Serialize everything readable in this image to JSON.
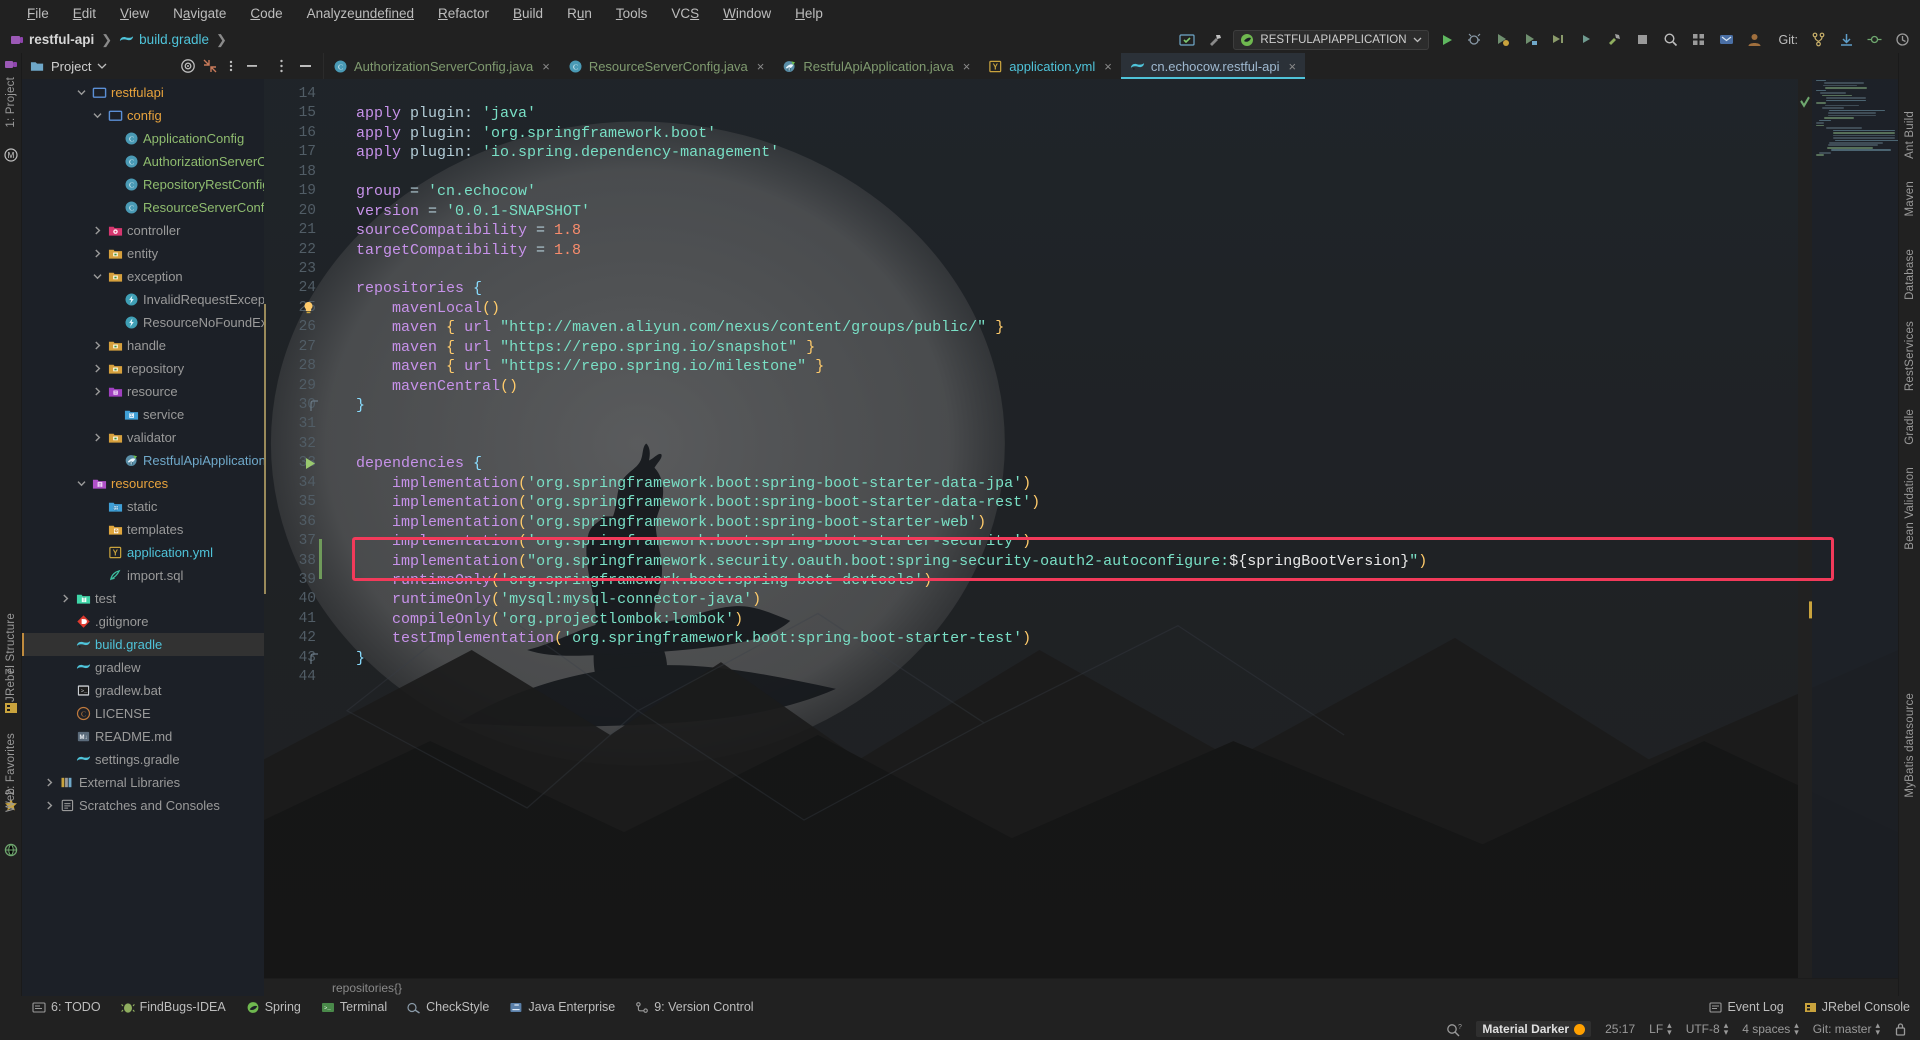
{
  "menubar": {
    "items": [
      "File",
      "Edit",
      "View",
      "Navigate",
      "Code",
      "Analyze",
      "Refactor",
      "Build",
      "Run",
      "Tools",
      "VCS",
      "Window",
      "Help"
    ]
  },
  "breadcrumb": {
    "project": "restful-api",
    "file": "build.gradle",
    "sep": "❯"
  },
  "toolbar": {
    "run_config": "RESTFULAPIAPPLICATION",
    "git_label": "Git:",
    "icons": [
      "updates-icon",
      "hammer-icon",
      "run-config-select",
      "run-icon",
      "debug-icon",
      "run-coverage-icon",
      "profiler-icon",
      "rerun-icon",
      "attach-icon",
      "build-icon",
      "stop-icon",
      "search-everywhere-icon",
      "settings-icon",
      "notifications-icon",
      "avatar-icon",
      "git-branch-icon",
      "git-update-icon",
      "git-commit-icon",
      "git-history-icon"
    ]
  },
  "left_strip": {
    "project_label": "1: Project",
    "structure_label": "7: Structure",
    "jrebel_label": "JRebel",
    "favorites_label": "2: Favorites",
    "web_label": "Web"
  },
  "right_strip": {
    "ant_label": "Ant Build",
    "maven_label": "Maven",
    "database_label": "Database",
    "rest_label": "RestServices",
    "gradle_label": "Gradle",
    "bean_label": "Bean Validation",
    "mybatis_label": "MyBatis datasource"
  },
  "project_panel": {
    "title": "Project",
    "locate_icon": "target-icon",
    "collapse_icon": "collapse-all-icon",
    "options_icon": "more-options-icon",
    "hide_icon": "hide-panel-icon",
    "tree": [
      {
        "label": "restfulapi",
        "indent": 3,
        "arrow": "down",
        "icon": "folder-blue",
        "color": "#e8a33d",
        "bold": false
      },
      {
        "label": "config",
        "indent": 4,
        "arrow": "down",
        "icon": "folder-blue",
        "color": "#e8a33d",
        "bold": false
      },
      {
        "label": "ApplicationConfig",
        "indent": 5,
        "arrow": "none",
        "icon": "class-icon",
        "color": "#8fbc6f",
        "bold": false
      },
      {
        "label": "AuthorizationServerConfig",
        "indent": 5,
        "arrow": "none",
        "icon": "class-icon",
        "color": "#8fbc6f",
        "bold": false
      },
      {
        "label": "RepositoryRestConfig",
        "indent": 5,
        "arrow": "none",
        "icon": "class-icon",
        "color": "#8fbc6f",
        "bold": false
      },
      {
        "label": "ResourceServerConfig",
        "indent": 5,
        "arrow": "none",
        "icon": "class-icon",
        "color": "#8fbc6f",
        "bold": false
      },
      {
        "label": "controller",
        "indent": 4,
        "arrow": "right",
        "icon": "folder-pink",
        "color": "#9a9a9a",
        "bold": false
      },
      {
        "label": "entity",
        "indent": 4,
        "arrow": "right",
        "icon": "folder-pkg",
        "color": "#9a9a9a",
        "bold": false
      },
      {
        "label": "exception",
        "indent": 4,
        "arrow": "down",
        "icon": "folder-pkg",
        "color": "#9a9a9a",
        "bold": false
      },
      {
        "label": "InvalidRequestException",
        "indent": 5,
        "arrow": "none",
        "icon": "exception-icon",
        "color": "#9a9a9a",
        "bold": false
      },
      {
        "label": "ResourceNoFoundException",
        "indent": 5,
        "arrow": "none",
        "icon": "exception-icon",
        "color": "#9a9a9a",
        "bold": false
      },
      {
        "label": "handle",
        "indent": 4,
        "arrow": "right",
        "icon": "folder-pkg",
        "color": "#9a9a9a",
        "bold": false
      },
      {
        "label": "repository",
        "indent": 4,
        "arrow": "right",
        "icon": "folder-pkg",
        "color": "#9a9a9a",
        "bold": false
      },
      {
        "label": "resource",
        "indent": 4,
        "arrow": "right",
        "icon": "folder-purple",
        "color": "#9a9a9a",
        "bold": false
      },
      {
        "label": "service",
        "indent": 5,
        "arrow": "none",
        "icon": "folder-sigma",
        "color": "#9a9a9a",
        "bold": false
      },
      {
        "label": "validator",
        "indent": 4,
        "arrow": "right",
        "icon": "folder-pkg",
        "color": "#9a9a9a",
        "bold": false
      },
      {
        "label": "RestfulApiApplication",
        "indent": 5,
        "arrow": "none",
        "icon": "spring-class-icon",
        "color": "#6fa8c9",
        "bold": false
      },
      {
        "label": "resources",
        "indent": 3,
        "arrow": "down",
        "icon": "folder-res",
        "color": "#e8a33d",
        "bold": false
      },
      {
        "label": "static",
        "indent": 4,
        "arrow": "none",
        "icon": "folder-web",
        "color": "#9a9a9a",
        "bold": false
      },
      {
        "label": "templates",
        "indent": 4,
        "arrow": "none",
        "icon": "folder-tmpl",
        "color": "#9a9a9a",
        "bold": false
      },
      {
        "label": "application.yml",
        "indent": 4,
        "arrow": "none",
        "icon": "yaml-icon",
        "color": "#4fc3d9",
        "bold": false
      },
      {
        "label": "import.sql",
        "indent": 4,
        "arrow": "none",
        "icon": "sql-icon",
        "color": "#9a9a9a",
        "bold": false
      },
      {
        "label": "test",
        "indent": 2,
        "arrow": "right",
        "icon": "folder-test",
        "color": "#9a9a9a",
        "bold": false
      },
      {
        "label": ".gitignore",
        "indent": 2,
        "arrow": "none",
        "icon": "gitignore-icon",
        "color": "#9a9a9a",
        "bold": false
      },
      {
        "label": "build.gradle",
        "indent": 2,
        "arrow": "none",
        "icon": "gradle-icon",
        "color": "#4fc3d9",
        "bold": false,
        "selected": true
      },
      {
        "label": "gradlew",
        "indent": 2,
        "arrow": "none",
        "icon": "gradle-icon",
        "color": "#9a9a9a",
        "bold": false
      },
      {
        "label": "gradlew.bat",
        "indent": 2,
        "arrow": "none",
        "icon": "bat-icon",
        "color": "#9a9a9a",
        "bold": false
      },
      {
        "label": "LICENSE",
        "indent": 2,
        "arrow": "none",
        "icon": "license-icon",
        "color": "#9a9a9a",
        "bold": false
      },
      {
        "label": "README.md",
        "indent": 2,
        "arrow": "none",
        "icon": "md-icon",
        "color": "#9a9a9a",
        "bold": false
      },
      {
        "label": "settings.gradle",
        "indent": 2,
        "arrow": "none",
        "icon": "gradle-icon",
        "color": "#9a9a9a",
        "bold": false
      },
      {
        "label": "External Libraries",
        "indent": 1,
        "arrow": "right",
        "icon": "libraries-icon",
        "color": "#9a9a9a",
        "bold": false
      },
      {
        "label": "Scratches and Consoles",
        "indent": 1,
        "arrow": "right",
        "icon": "scratches-icon",
        "color": "#9a9a9a",
        "bold": false
      }
    ]
  },
  "editor_tabs": [
    {
      "label": "AuthorizationServerConfig.java",
      "icon": "class-icon",
      "active": false,
      "kind": "java"
    },
    {
      "label": "ResourceServerConfig.java",
      "icon": "class-icon",
      "active": false,
      "kind": "java"
    },
    {
      "label": "RestfulApiApplication.java",
      "icon": "spring-class-icon",
      "active": false,
      "kind": "spring"
    },
    {
      "label": "application.yml",
      "icon": "yaml-icon",
      "active": false,
      "kind": "yml"
    },
    {
      "label": "cn.echocow.restful-api",
      "icon": "gradle-icon",
      "active": true,
      "kind": "gradle"
    }
  ],
  "code": {
    "first_line": 14,
    "lines": [
      {
        "n": 14,
        "tokens": []
      },
      {
        "n": 15,
        "tokens": [
          {
            "t": "apply",
            "c": "k"
          },
          {
            "t": " plugin: ",
            "c": "g"
          },
          {
            "t": "'java'",
            "c": "s"
          }
        ]
      },
      {
        "n": 16,
        "tokens": [
          {
            "t": "apply",
            "c": "k"
          },
          {
            "t": " plugin: ",
            "c": "g"
          },
          {
            "t": "'org.springframework.boot'",
            "c": "s"
          }
        ]
      },
      {
        "n": 17,
        "tokens": [
          {
            "t": "apply",
            "c": "k"
          },
          {
            "t": " plugin: ",
            "c": "g"
          },
          {
            "t": "'io.spring.dependency-management'",
            "c": "s"
          }
        ]
      },
      {
        "n": 18,
        "tokens": []
      },
      {
        "n": 19,
        "tokens": [
          {
            "t": "group",
            "c": "k"
          },
          {
            "t": " = ",
            "c": "g"
          },
          {
            "t": "'cn.echocow'",
            "c": "s"
          }
        ]
      },
      {
        "n": 20,
        "tokens": [
          {
            "t": "version",
            "c": "k"
          },
          {
            "t": " = ",
            "c": "g"
          },
          {
            "t": "'0.0.1-SNAPSHOT'",
            "c": "s"
          }
        ]
      },
      {
        "n": 21,
        "tokens": [
          {
            "t": "sourceCompatibility",
            "c": "k"
          },
          {
            "t": " = ",
            "c": "g"
          },
          {
            "t": "1.8",
            "c": "n"
          }
        ]
      },
      {
        "n": 22,
        "tokens": [
          {
            "t": "targetCompatibility",
            "c": "k"
          },
          {
            "t": " = ",
            "c": "g"
          },
          {
            "t": "1.8",
            "c": "n"
          }
        ]
      },
      {
        "n": 23,
        "tokens": []
      },
      {
        "n": 24,
        "tokens": [
          {
            "t": "repositories",
            "c": "k"
          },
          {
            "t": " ",
            "c": "g"
          },
          {
            "t": "{",
            "c": "br"
          }
        ]
      },
      {
        "n": 25,
        "tokens": [
          {
            "t": "    ",
            "c": "g"
          },
          {
            "t": "mavenLocal",
            "c": "k"
          },
          {
            "t": "()",
            "c": "p"
          }
        ],
        "bulb": true
      },
      {
        "n": 26,
        "tokens": [
          {
            "t": "    ",
            "c": "g"
          },
          {
            "t": "maven",
            "c": "k"
          },
          {
            "t": " ",
            "c": "g"
          },
          {
            "t": "{",
            "c": "p"
          },
          {
            "t": " ",
            "c": "g"
          },
          {
            "t": "url",
            "c": "k"
          },
          {
            "t": " ",
            "c": "g"
          },
          {
            "t": "\"http://maven.aliyun.com/nexus/content/groups/public/\"",
            "c": "s"
          },
          {
            "t": " ",
            "c": "g"
          },
          {
            "t": "}",
            "c": "p"
          }
        ]
      },
      {
        "n": 27,
        "tokens": [
          {
            "t": "    ",
            "c": "g"
          },
          {
            "t": "maven",
            "c": "k"
          },
          {
            "t": " ",
            "c": "g"
          },
          {
            "t": "{",
            "c": "p"
          },
          {
            "t": " ",
            "c": "g"
          },
          {
            "t": "url",
            "c": "k"
          },
          {
            "t": " ",
            "c": "g"
          },
          {
            "t": "\"https://repo.spring.io/snapshot\"",
            "c": "s"
          },
          {
            "t": " ",
            "c": "g"
          },
          {
            "t": "}",
            "c": "p"
          }
        ]
      },
      {
        "n": 28,
        "tokens": [
          {
            "t": "    ",
            "c": "g"
          },
          {
            "t": "maven",
            "c": "k"
          },
          {
            "t": " ",
            "c": "g"
          },
          {
            "t": "{",
            "c": "p"
          },
          {
            "t": " ",
            "c": "g"
          },
          {
            "t": "url",
            "c": "k"
          },
          {
            "t": " ",
            "c": "g"
          },
          {
            "t": "\"https://repo.spring.io/milestone\"",
            "c": "s"
          },
          {
            "t": " ",
            "c": "g"
          },
          {
            "t": "}",
            "c": "p"
          }
        ]
      },
      {
        "n": 29,
        "tokens": [
          {
            "t": "    ",
            "c": "g"
          },
          {
            "t": "mavenCentral",
            "c": "k"
          },
          {
            "t": "()",
            "c": "p"
          }
        ]
      },
      {
        "n": 30,
        "tokens": [
          {
            "t": "}",
            "c": "br"
          }
        ],
        "fold": true
      },
      {
        "n": 31,
        "tokens": []
      },
      {
        "n": 32,
        "tokens": []
      },
      {
        "n": 33,
        "tokens": [
          {
            "t": "dependencies",
            "c": "k"
          },
          {
            "t": " ",
            "c": "g"
          },
          {
            "t": "{",
            "c": "br"
          }
        ],
        "run": true
      },
      {
        "n": 34,
        "tokens": [
          {
            "t": "    ",
            "c": "g"
          },
          {
            "t": "implementation",
            "c": "k"
          },
          {
            "t": "(",
            "c": "p"
          },
          {
            "t": "'org.springframework.boot:spring-boot-starter-data-jpa'",
            "c": "s"
          },
          {
            "t": ")",
            "c": "p"
          }
        ]
      },
      {
        "n": 35,
        "tokens": [
          {
            "t": "    ",
            "c": "g"
          },
          {
            "t": "implementation",
            "c": "k"
          },
          {
            "t": "(",
            "c": "p"
          },
          {
            "t": "'org.springframework.boot:spring-boot-starter-data-rest'",
            "c": "s"
          },
          {
            "t": ")",
            "c": "p"
          }
        ]
      },
      {
        "n": 36,
        "tokens": [
          {
            "t": "    ",
            "c": "g"
          },
          {
            "t": "implementation",
            "c": "k"
          },
          {
            "t": "(",
            "c": "p"
          },
          {
            "t": "'org.springframework.boot:spring-boot-starter-web'",
            "c": "s"
          },
          {
            "t": ")",
            "c": "p"
          }
        ]
      },
      {
        "n": 37,
        "tokens": [
          {
            "t": "    ",
            "c": "g"
          },
          {
            "t": "implementation",
            "c": "k"
          },
          {
            "t": "(",
            "c": "p"
          },
          {
            "t": "'org.springframework.boot:spring-boot-starter-security'",
            "c": "s"
          },
          {
            "t": ")",
            "c": "p"
          }
        ],
        "highlight": true
      },
      {
        "n": 38,
        "tokens": [
          {
            "t": "    ",
            "c": "g"
          },
          {
            "t": "implementation",
            "c": "k"
          },
          {
            "t": "(",
            "c": "p"
          },
          {
            "t": "\"org.springframework.security.oauth.boot:spring-security-oauth2-autoconfigure:",
            "c": "s"
          },
          {
            "t": "${springBootVersion}",
            "c": "tpl"
          },
          {
            "t": "\"",
            "c": "s"
          },
          {
            "t": ")",
            "c": "p"
          }
        ],
        "highlight": true
      },
      {
        "n": 39,
        "tokens": [
          {
            "t": "    ",
            "c": "g"
          },
          {
            "t": "runtimeOnly",
            "c": "k"
          },
          {
            "t": "(",
            "c": "p"
          },
          {
            "t": "'org.springframework.boot:spring-boot-devtools'",
            "c": "s"
          },
          {
            "t": ")",
            "c": "p"
          }
        ]
      },
      {
        "n": 40,
        "tokens": [
          {
            "t": "    ",
            "c": "g"
          },
          {
            "t": "runtimeOnly",
            "c": "k"
          },
          {
            "t": "(",
            "c": "p"
          },
          {
            "t": "'mysql:mysql-connector-java'",
            "c": "s"
          },
          {
            "t": ")",
            "c": "p"
          }
        ]
      },
      {
        "n": 41,
        "tokens": [
          {
            "t": "    ",
            "c": "g"
          },
          {
            "t": "compileOnly",
            "c": "k"
          },
          {
            "t": "(",
            "c": "p"
          },
          {
            "t": "'org.projectlombok:lombok'",
            "c": "s"
          },
          {
            "t": ")",
            "c": "p"
          }
        ]
      },
      {
        "n": 42,
        "tokens": [
          {
            "t": "    ",
            "c": "g"
          },
          {
            "t": "testImplementation",
            "c": "k"
          },
          {
            "t": "(",
            "c": "p"
          },
          {
            "t": "'org.springframework.boot:spring-boot-starter-test'",
            "c": "s"
          },
          {
            "t": ")",
            "c": "p"
          }
        ]
      },
      {
        "n": 43,
        "tokens": [
          {
            "t": "}",
            "c": "br"
          }
        ],
        "fold": true
      },
      {
        "n": 44,
        "tokens": []
      }
    ]
  },
  "editor_breadcrumb": "repositories{}",
  "bottom_toolwindows": [
    {
      "label": "6: TODO",
      "icon": "todo-icon"
    },
    {
      "label": "FindBugs-IDEA",
      "icon": "findbugs-icon"
    },
    {
      "label": "Spring",
      "icon": "spring-icon"
    },
    {
      "label": "Terminal",
      "icon": "terminal-icon"
    },
    {
      "label": "CheckStyle",
      "icon": "checkstyle-icon"
    },
    {
      "label": "Java Enterprise",
      "icon": "javaee-icon"
    },
    {
      "label": "9: Version Control",
      "icon": "vcs-icon"
    }
  ],
  "bottom_right": [
    {
      "label": "Event Log",
      "icon": "event-log-icon"
    },
    {
      "label": "JRebel Console",
      "icon": "jrebel-icon"
    }
  ],
  "statusbar": {
    "theme": "Material Darker",
    "theme_dot_color": "#ffa000",
    "caret": "25:17",
    "line_sep": "LF",
    "encoding": "UTF-8",
    "indent": "4 spaces",
    "git_branch": "Git: master",
    "inspection_icon": "inspection-icon",
    "lock_icon": "lock-icon"
  },
  "colors": {
    "bg": "#212121",
    "panel_bg": "#1c2027",
    "accent": "#4fc3d9",
    "highlight_red": "#f23a5a",
    "string_green": "#79e0c6",
    "keyword_purple": "#c792ea"
  }
}
